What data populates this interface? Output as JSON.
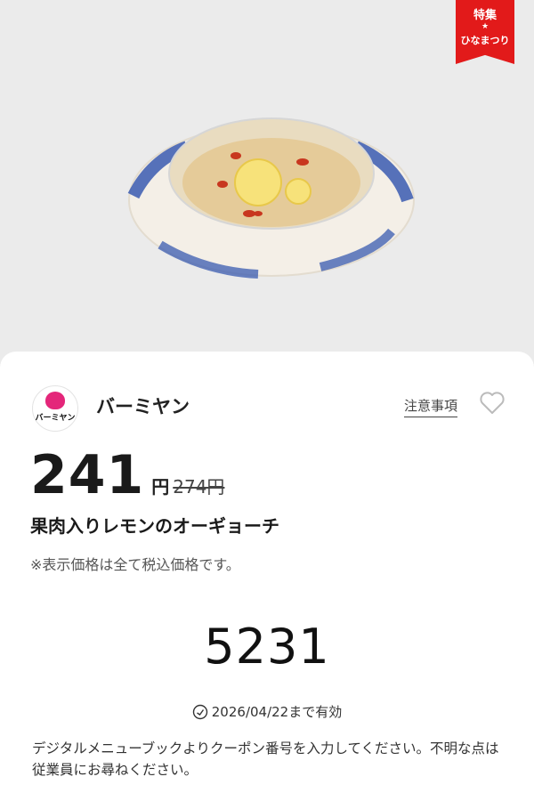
{
  "ribbon": {
    "line1": "特集",
    "star": "★",
    "line2": "ひなまつり"
  },
  "store": {
    "name": "バーミヤン",
    "logo_text": "バーミヤン"
  },
  "notice_link": "注意事項",
  "price": {
    "current": "241",
    "unit": "円",
    "original": "274円"
  },
  "product_name": "果肉入りレモンのオーギョーチ",
  "tax_note": "※表示価格は全て税込価格です。",
  "coupon_code": "5231",
  "validity": "2026/04/22まで有効",
  "instructions": "デジタルメニューブックよりクーポン番号を入力してください。不明な点は従業員にお尋ねください。",
  "colors": {
    "ribbon": "#e21a1a",
    "peach": "#e4267a"
  },
  "icons": {
    "favorite": "heart-icon",
    "validity": "clock-icon"
  }
}
